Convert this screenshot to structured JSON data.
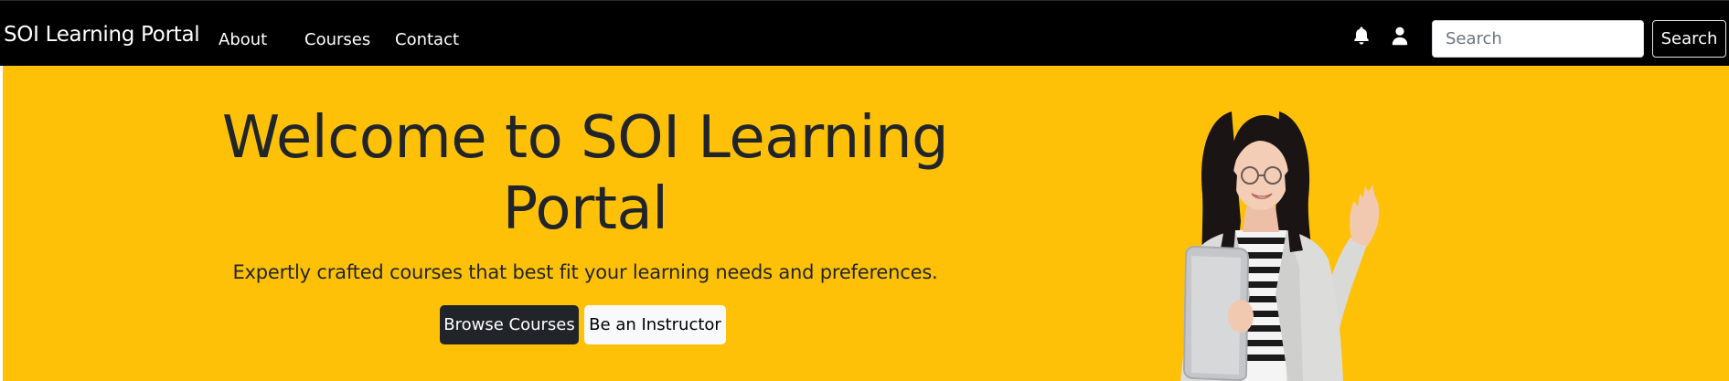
{
  "navbar": {
    "brand": "SOI Learning Portal",
    "links": [
      {
        "label": "About"
      },
      {
        "label": "Courses"
      },
      {
        "label": "Contact"
      }
    ],
    "icons": {
      "notifications": "bell-icon",
      "profile": "user-icon"
    },
    "search": {
      "placeholder": "Search",
      "value": "",
      "button_label": "Search"
    }
  },
  "hero": {
    "title": "Welcome to SOI Learning Portal",
    "subtitle": "Expertly crafted courses that best fit your learning needs and preferences.",
    "primary_button": "Browse Courses",
    "secondary_button": "Be an Instructor",
    "image": "woman-with-laptop-waving"
  },
  "colors": {
    "navbar_background": "#000000",
    "hero_background": "#ffc107",
    "text_dark": "#212529",
    "primary_button": "#212529",
    "secondary_button": "#f8f9fa"
  }
}
